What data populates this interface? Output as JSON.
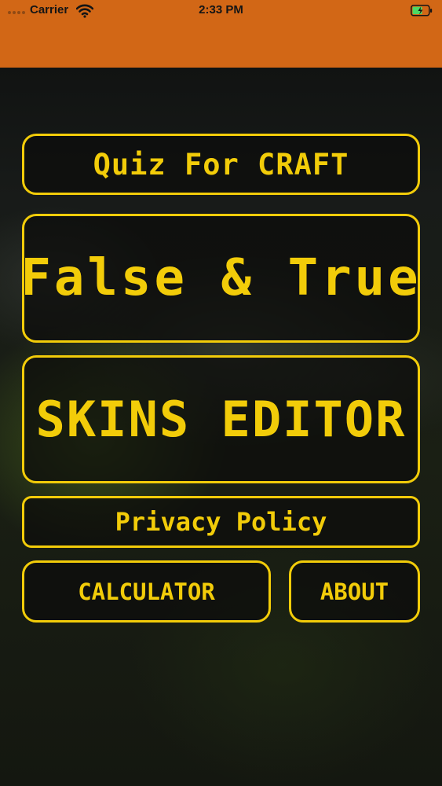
{
  "status_bar": {
    "carrier": "Carrier",
    "time": "2:33 PM",
    "wifi_icon": "wifi-icon",
    "battery_icon": "battery-charging-icon",
    "background_color": "#d26716"
  },
  "menu": {
    "quiz_label": "Quiz For CRAFT",
    "false_true_label": "False & True",
    "skins_editor_label": "SKINS EDITOR",
    "privacy_policy_label": "Privacy Policy",
    "calculator_label": "CALCULATOR",
    "about_label": "ABOUT"
  },
  "colors": {
    "accent": "#f2cc09",
    "background": "#121413",
    "battery_charge": "#4cd964"
  }
}
